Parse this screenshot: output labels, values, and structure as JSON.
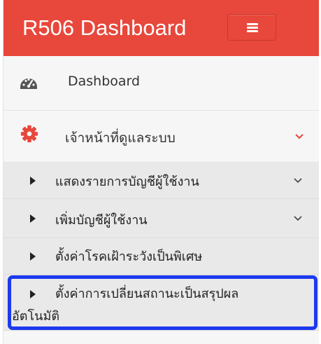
{
  "header": {
    "brand": "R506 Dashboard",
    "menu_toggle_icon": "hamburger-icon",
    "background_color": "#e8473b"
  },
  "sidebar": {
    "items": [
      {
        "label": "Dashboard",
        "icon": "dashboard-gauge-icon"
      },
      {
        "label": "เจ้าหน้าที่ดูแลระบบ",
        "icon": "gear-icon",
        "expanded": true,
        "icon_color": "#e8473b"
      }
    ],
    "submenu": [
      {
        "label": "แสดงรายการบัญชีผู้ใช้งาน",
        "has_children": true
      },
      {
        "label": "เพิ่มบัญชีผู้ใช้งาน",
        "has_children": true
      },
      {
        "label": "ตั้งค่าโรคเฝ้าระวังเป็นพิเศษ",
        "has_children": false
      },
      {
        "label_line1": "ตั้งค่าการเปลี่ยนสถานะเป็นสรุปผล",
        "label_line2": "อัตโนมัติ",
        "has_children": false,
        "highlighted": true
      }
    ]
  },
  "highlight_color": "#1d39ee"
}
